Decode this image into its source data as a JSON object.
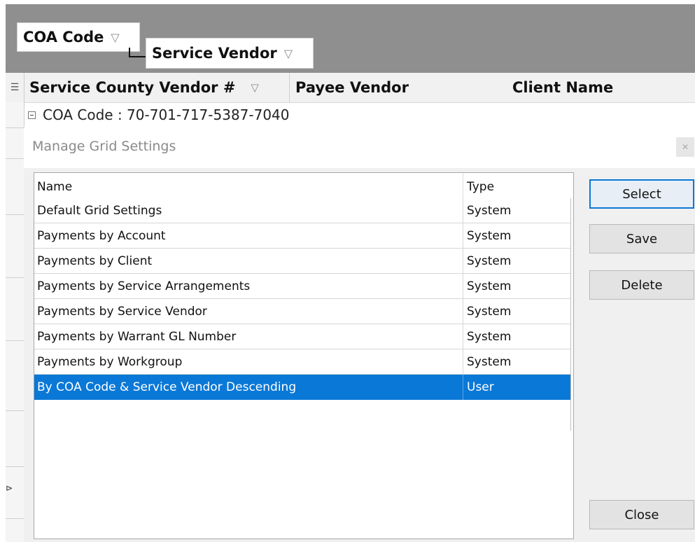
{
  "group_panel": {
    "chips": [
      {
        "label": "COA Code",
        "filter_icon": "filter-icon"
      },
      {
        "label": "Service Vendor",
        "filter_icon": "filter-icon"
      }
    ]
  },
  "grid": {
    "columns": [
      {
        "label": "Service County Vendor #"
      },
      {
        "label": "Payee Vendor"
      },
      {
        "label": "Client Name"
      }
    ],
    "group_row": "COA Code : 70-701-717-5387-7040"
  },
  "dialog": {
    "title": "Manage Grid Settings",
    "list_headers": {
      "name": "Name",
      "type": "Type"
    },
    "rows": [
      {
        "name": "Default Grid Settings",
        "type": "System"
      },
      {
        "name": "Payments by Account",
        "type": "System"
      },
      {
        "name": "Payments by Client",
        "type": "System"
      },
      {
        "name": "Payments by Service Arrangements",
        "type": "System"
      },
      {
        "name": "Payments by Service Vendor",
        "type": "System"
      },
      {
        "name": "Payments by Warrant GL Number",
        "type": "System"
      },
      {
        "name": "Payments by Workgroup",
        "type": "System"
      },
      {
        "name": "By COA Code & Service Vendor Descending",
        "type": "User"
      }
    ],
    "selected_index": 7,
    "buttons": {
      "select": "Select",
      "save": "Save",
      "delete": "Delete",
      "close": "Close"
    }
  },
  "colors": {
    "selection": "#0a78d7",
    "group_panel": "#8f8f8f"
  }
}
